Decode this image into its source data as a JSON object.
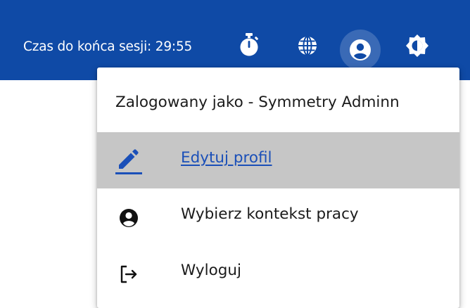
{
  "header": {
    "session_label": "Czas do końca sesji: 29:55",
    "icons": [
      "timer-icon",
      "globe-icon",
      "account-circle-icon",
      "contrast-icon"
    ],
    "background_color": "#0f4aa6"
  },
  "user_menu": {
    "logged_in_as": "Zalogowany jako - Symmetry Adminn",
    "items": [
      {
        "label": "Edytuj profil",
        "icon": "pencil-icon",
        "highlighted": true
      },
      {
        "label": "Wybierz kontekst pracy",
        "icon": "account-circle-icon",
        "highlighted": false
      },
      {
        "label": "Wyloguj",
        "icon": "logout-icon",
        "highlighted": false
      }
    ],
    "highlight_color": "#c6c6c6",
    "link_color": "#1a4fb8"
  }
}
